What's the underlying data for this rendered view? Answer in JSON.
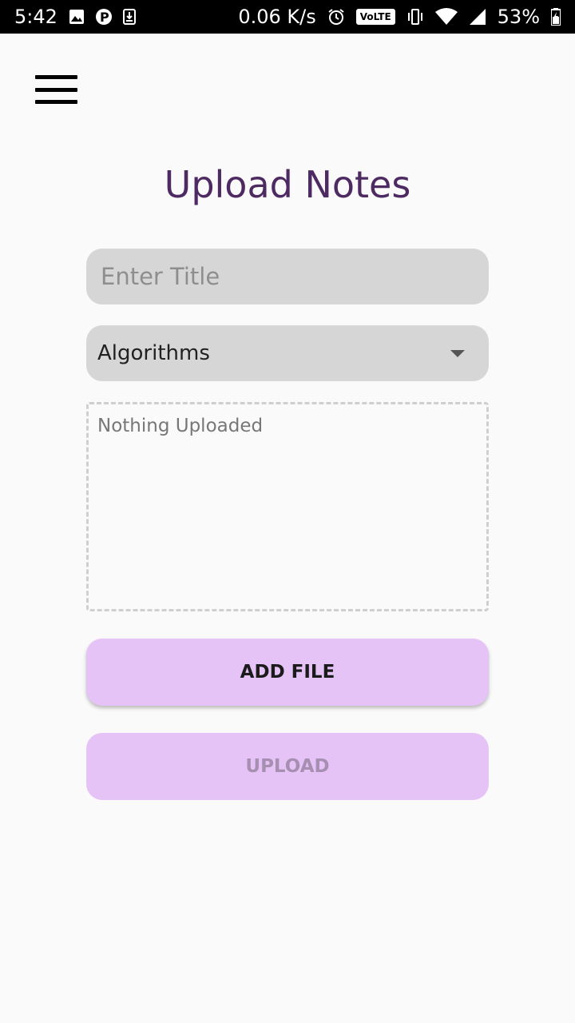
{
  "status_bar": {
    "time": "5:42",
    "speed": "0.06 K/s",
    "volte": "VoLTE",
    "battery": "53%"
  },
  "menu": {
    "icon": "hamburger-menu-icon"
  },
  "page": {
    "title": "Upload Notes"
  },
  "form": {
    "title_placeholder": "Enter Title",
    "title_value": "",
    "subject_selected": "Algorithms",
    "uploaded_status": "Nothing Uploaded",
    "add_file_label": "ADD FILE",
    "upload_label": "UPLOAD"
  },
  "colors": {
    "title": "#4e2a63",
    "button_bg": "#e6c3f6",
    "field_bg": "#d6d6d6"
  }
}
